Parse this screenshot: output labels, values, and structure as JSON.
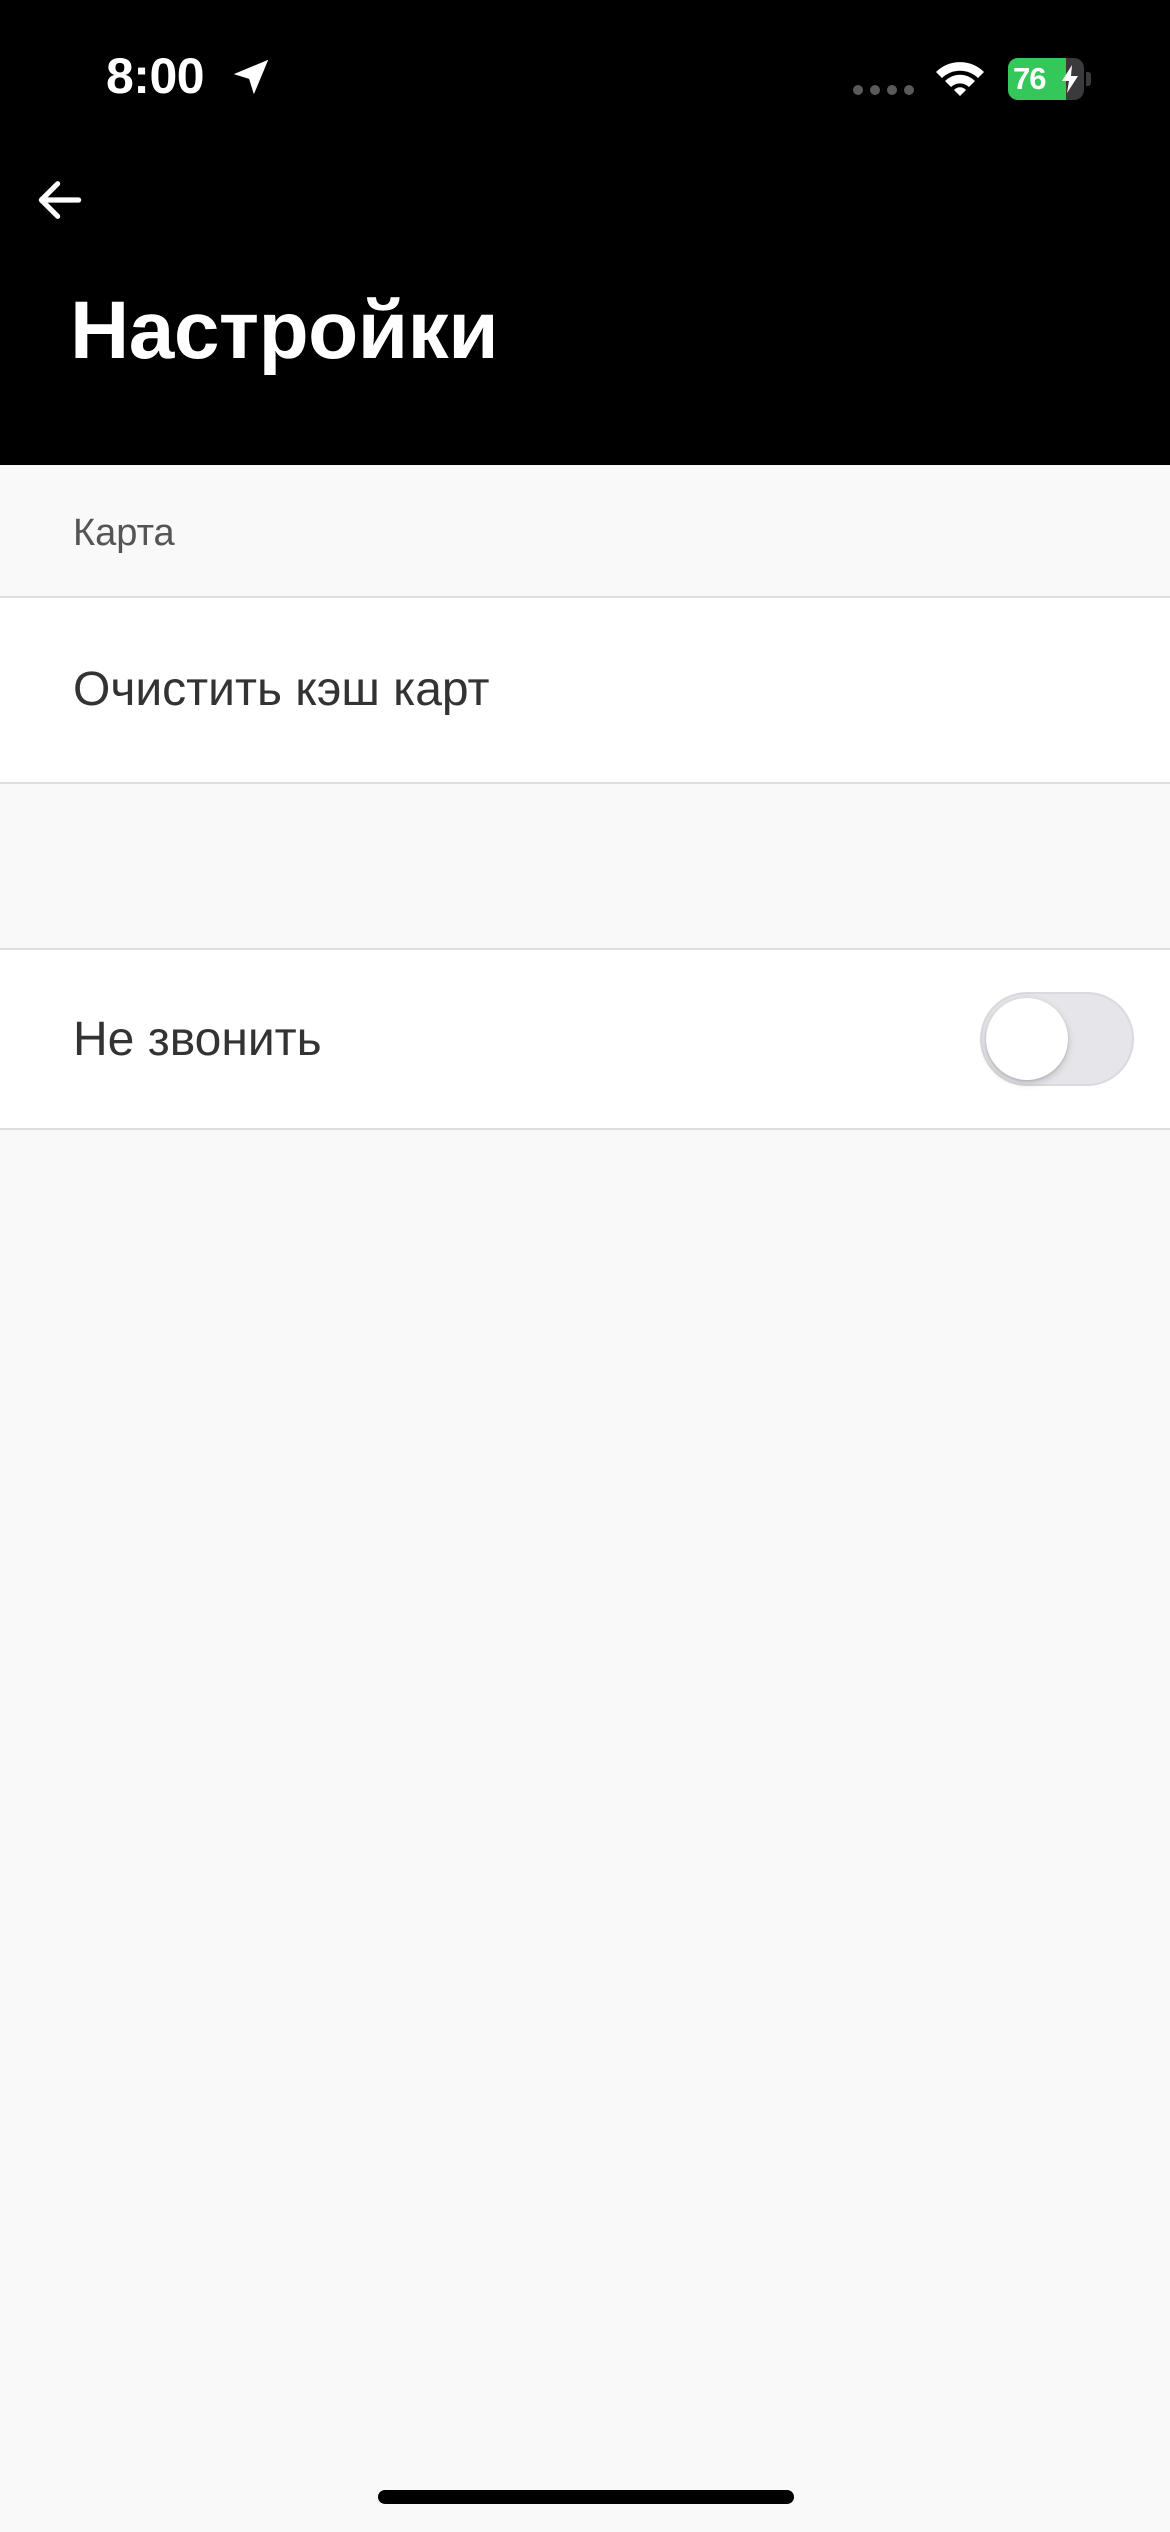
{
  "status_bar": {
    "time": "8:00",
    "battery_level": "76",
    "battery_fraction": 0.76,
    "location_icon": "location-arrow-icon",
    "signal_icon": "cellular-signal-icon",
    "wifi_icon": "wifi-icon",
    "charging_icon": "bolt-icon"
  },
  "header": {
    "back_icon": "arrow-left-icon",
    "title": "Настройки"
  },
  "sections": {
    "map": {
      "header": "Карта",
      "clear_cache_label": "Очистить кэш карт"
    },
    "calls": {
      "do_not_call_label": "Не звонить",
      "do_not_call_enabled": false
    }
  },
  "colors": {
    "header_bg": "#000000",
    "background": "#f9f9f9",
    "row_bg": "#ffffff",
    "battery_green": "#34c759",
    "toggle_off": "#e5e5ea"
  }
}
